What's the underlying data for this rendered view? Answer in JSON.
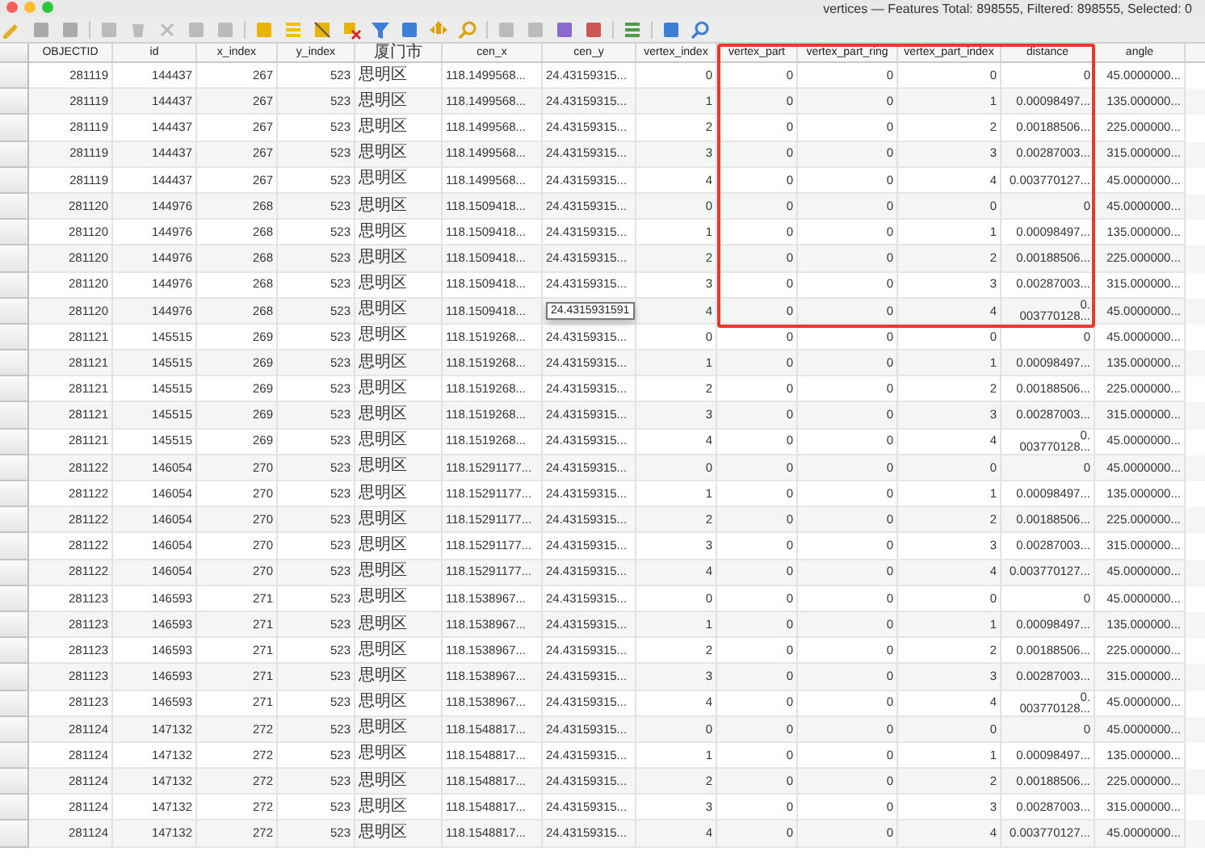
{
  "window": {
    "title": "vertices — Features Total: 898555, Filtered: 898555, Selected: 0"
  },
  "table": {
    "columns": [
      "OBJECTID",
      "id",
      "x_index",
      "y_index",
      "厦门市",
      "cen_x",
      "cen_y",
      "vertex_index",
      "vertex_part",
      "vertex_part_ring",
      "vertex_part_index",
      "distance",
      "angle"
    ],
    "rows": [
      {
        "cells": [
          "281119",
          "144437",
          "267",
          "523",
          "思明区",
          "118.1499568...",
          "24.43159315...",
          "0",
          "0",
          "0",
          "0",
          "0",
          "45.0000000..."
        ]
      },
      {
        "cells": [
          "281119",
          "144437",
          "267",
          "523",
          "思明区",
          "118.1499568...",
          "24.43159315...",
          "1",
          "0",
          "0",
          "1",
          "0.00098497...",
          "135.000000..."
        ]
      },
      {
        "cells": [
          "281119",
          "144437",
          "267",
          "523",
          "思明区",
          "118.1499568...",
          "24.43159315...",
          "2",
          "0",
          "0",
          "2",
          "0.00188506...",
          "225.000000..."
        ]
      },
      {
        "cells": [
          "281119",
          "144437",
          "267",
          "523",
          "思明区",
          "118.1499568...",
          "24.43159315...",
          "3",
          "0",
          "0",
          "3",
          "0.00287003...",
          "315.000000..."
        ]
      },
      {
        "cells": [
          "281119",
          "144437",
          "267",
          "523",
          "思明区",
          "118.1499568...",
          "24.43159315...",
          "4",
          "0",
          "0",
          "4",
          "0.003770127...",
          "45.0000000..."
        ]
      },
      {
        "cells": [
          "281120",
          "144976",
          "268",
          "523",
          "思明区",
          "118.1509418...",
          "24.43159315...",
          "0",
          "0",
          "0",
          "0",
          "0",
          "45.0000000..."
        ]
      },
      {
        "cells": [
          "281120",
          "144976",
          "268",
          "523",
          "思明区",
          "118.1509418...",
          "24.43159315...",
          "1",
          "0",
          "0",
          "1",
          "0.00098497...",
          "135.000000..."
        ]
      },
      {
        "cells": [
          "281120",
          "144976",
          "268",
          "523",
          "思明区",
          "118.1509418...",
          "24.43159315...",
          "2",
          "0",
          "0",
          "2",
          "0.00188506...",
          "225.000000..."
        ]
      },
      {
        "cells": [
          "281120",
          "144976",
          "268",
          "523",
          "思明区",
          "118.1509418...",
          "24.43159315...",
          "3",
          "0",
          "0",
          "3",
          "0.00287003...",
          "315.000000..."
        ]
      },
      {
        "cells": [
          "281120",
          "144976",
          "268",
          "523",
          "思明区",
          "118.1509418...",
          {
            "tooltip": "24.4315931591"
          },
          "4",
          "0",
          "0",
          "4",
          "0.\n003770128...",
          "45.0000000..."
        ]
      },
      {
        "cells": [
          "281121",
          "145515",
          "269",
          "523",
          "思明区",
          "118.1519268...",
          "24.43159315...",
          "0",
          "0",
          "0",
          "0",
          "0",
          "45.0000000..."
        ]
      },
      {
        "cells": [
          "281121",
          "145515",
          "269",
          "523",
          "思明区",
          "118.1519268...",
          "24.43159315...",
          "1",
          "0",
          "0",
          "1",
          "0.00098497...",
          "135.000000..."
        ]
      },
      {
        "cells": [
          "281121",
          "145515",
          "269",
          "523",
          "思明区",
          "118.1519268...",
          "24.43159315...",
          "2",
          "0",
          "0",
          "2",
          "0.00188506...",
          "225.000000..."
        ]
      },
      {
        "cells": [
          "281121",
          "145515",
          "269",
          "523",
          "思明区",
          "118.1519268...",
          "24.43159315...",
          "3",
          "0",
          "0",
          "3",
          "0.00287003...",
          "315.000000..."
        ]
      },
      {
        "cells": [
          "281121",
          "145515",
          "269",
          "523",
          "思明区",
          "118.1519268...",
          "24.43159315...",
          "4",
          "0",
          "0",
          "4",
          "0.\n003770128...",
          "45.0000000..."
        ]
      },
      {
        "cells": [
          "281122",
          "146054",
          "270",
          "523",
          "思明区",
          "118.15291177...",
          "24.43159315...",
          "0",
          "0",
          "0",
          "0",
          "0",
          "45.0000000..."
        ]
      },
      {
        "cells": [
          "281122",
          "146054",
          "270",
          "523",
          "思明区",
          "118.15291177...",
          "24.43159315...",
          "1",
          "0",
          "0",
          "1",
          "0.00098497...",
          "135.000000..."
        ]
      },
      {
        "cells": [
          "281122",
          "146054",
          "270",
          "523",
          "思明区",
          "118.15291177...",
          "24.43159315...",
          "2",
          "0",
          "0",
          "2",
          "0.00188506...",
          "225.000000..."
        ]
      },
      {
        "cells": [
          "281122",
          "146054",
          "270",
          "523",
          "思明区",
          "118.15291177...",
          "24.43159315...",
          "3",
          "0",
          "0",
          "3",
          "0.00287003...",
          "315.000000..."
        ]
      },
      {
        "cells": [
          "281122",
          "146054",
          "270",
          "523",
          "思明区",
          "118.15291177...",
          "24.43159315...",
          "4",
          "0",
          "0",
          "4",
          "0.003770127...",
          "45.0000000..."
        ]
      },
      {
        "cells": [
          "281123",
          "146593",
          "271",
          "523",
          "思明区",
          "118.1538967...",
          "24.43159315...",
          "0",
          "0",
          "0",
          "0",
          "0",
          "45.0000000..."
        ]
      },
      {
        "cells": [
          "281123",
          "146593",
          "271",
          "523",
          "思明区",
          "118.1538967...",
          "24.43159315...",
          "1",
          "0",
          "0",
          "1",
          "0.00098497...",
          "135.000000..."
        ]
      },
      {
        "cells": [
          "281123",
          "146593",
          "271",
          "523",
          "思明区",
          "118.1538967...",
          "24.43159315...",
          "2",
          "0",
          "0",
          "2",
          "0.00188506...",
          "225.000000..."
        ]
      },
      {
        "cells": [
          "281123",
          "146593",
          "271",
          "523",
          "思明区",
          "118.1538967...",
          "24.43159315...",
          "3",
          "0",
          "0",
          "3",
          "0.00287003...",
          "315.000000..."
        ]
      },
      {
        "cells": [
          "281123",
          "146593",
          "271",
          "523",
          "思明区",
          "118.1538967...",
          "24.43159315...",
          "4",
          "0",
          "0",
          "4",
          "0.\n003770128...",
          "45.0000000..."
        ]
      },
      {
        "cells": [
          "281124",
          "147132",
          "272",
          "523",
          "思明区",
          "118.1548817...",
          "24.43159315...",
          "0",
          "0",
          "0",
          "0",
          "0",
          "45.0000000..."
        ]
      },
      {
        "cells": [
          "281124",
          "147132",
          "272",
          "523",
          "思明区",
          "118.1548817...",
          "24.43159315...",
          "1",
          "0",
          "0",
          "1",
          "0.00098497...",
          "135.000000..."
        ]
      },
      {
        "cells": [
          "281124",
          "147132",
          "272",
          "523",
          "思明区",
          "118.1548817...",
          "24.43159315...",
          "2",
          "0",
          "0",
          "2",
          "0.00188506...",
          "225.000000..."
        ]
      },
      {
        "cells": [
          "281124",
          "147132",
          "272",
          "523",
          "思明区",
          "118.1548817...",
          "24.43159315...",
          "3",
          "0",
          "0",
          "3",
          "0.00287003...",
          "315.000000..."
        ]
      },
      {
        "cells": [
          "281124",
          "147132",
          "272",
          "523",
          "思明区",
          "118.1548817...",
          "24.43159315...",
          "4",
          "0",
          "0",
          "4",
          "0.003770127...",
          "45.0000000..."
        ]
      }
    ]
  }
}
